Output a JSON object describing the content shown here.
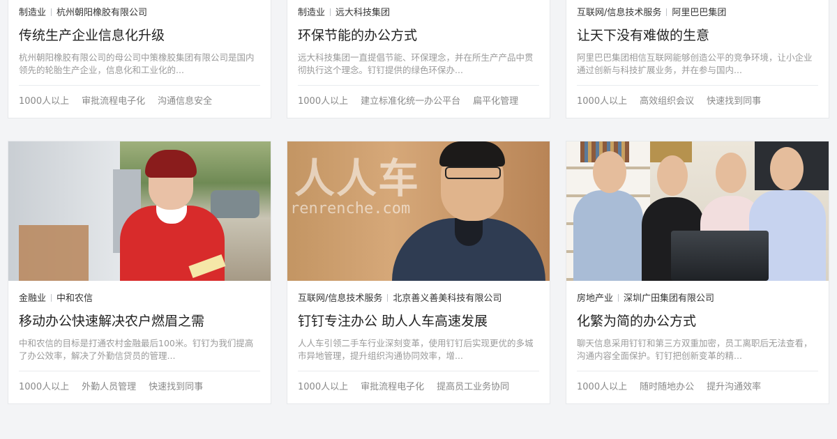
{
  "cards": [
    {
      "industry": "制造业",
      "company": "杭州朝阳橡胶有限公司",
      "title": "传统生产企业信息化升级",
      "desc": "杭州朝阳橡胶有限公司的母公司中策橡胶集团有限公司是国内领先的轮胎生产企业，信息化和工业化的...",
      "tags": [
        "1000人以上",
        "审批流程电子化",
        "沟通信息安全"
      ]
    },
    {
      "industry": "制造业",
      "company": "远大科技集团",
      "title": "环保节能的办公方式",
      "desc": "远大科技集团一直提倡节能、环保理念，并在所生产产品中贯彻执行这个理念。钉钉提供的绿色环保办...",
      "tags": [
        "1000人以上",
        "建立标准化统一办公平台",
        "扁平化管理"
      ]
    },
    {
      "industry": "互联网/信息技术服务",
      "company": "阿里巴巴集团",
      "title": "让天下没有难做的生意",
      "desc": "阿里巴巴集团相信互联网能够创造公平的竞争环境，让小企业通过创新与科技扩展业务，并在参与国内...",
      "tags": [
        "1000人以上",
        "高效组织会议",
        "快速找到同事"
      ]
    },
    {
      "industry": "金融业",
      "company": "中和农信",
      "title": "移动办公快速解决农户燃眉之需",
      "desc": "中和农信的目标是打通农村金融最后100米。钉钉为我们提高了办公效率，解决了外勤信贷员的管理...",
      "tags": [
        "1000人以上",
        "外勤人员管理",
        "快速找到同事"
      ]
    },
    {
      "industry": "互联网/信息技术服务",
      "company": "北京善义善美科技有限公司",
      "title": "钉钉专注办公 助人人车高速发展",
      "desc": "人人车引领二手车行业深刻变革，使用钉钉后实现更优的多城市异地管理，提升组织沟通协同效率，增...",
      "tags": [
        "1000人以上",
        "审批流程电子化",
        "提高员工业务协同"
      ],
      "photo_text": [
        "人人车",
        "renrenche.com"
      ]
    },
    {
      "industry": "房地产业",
      "company": "深圳广田集团有限公司",
      "title": "化繁为简的办公方式",
      "desc": "聊天信息采用钉钉和第三方双重加密，员工离职后无法查看，沟通内容全面保护。钉钉把创新变革的精...",
      "tags": [
        "1000人以上",
        "随时随地办公",
        "提升沟通效率"
      ]
    }
  ]
}
